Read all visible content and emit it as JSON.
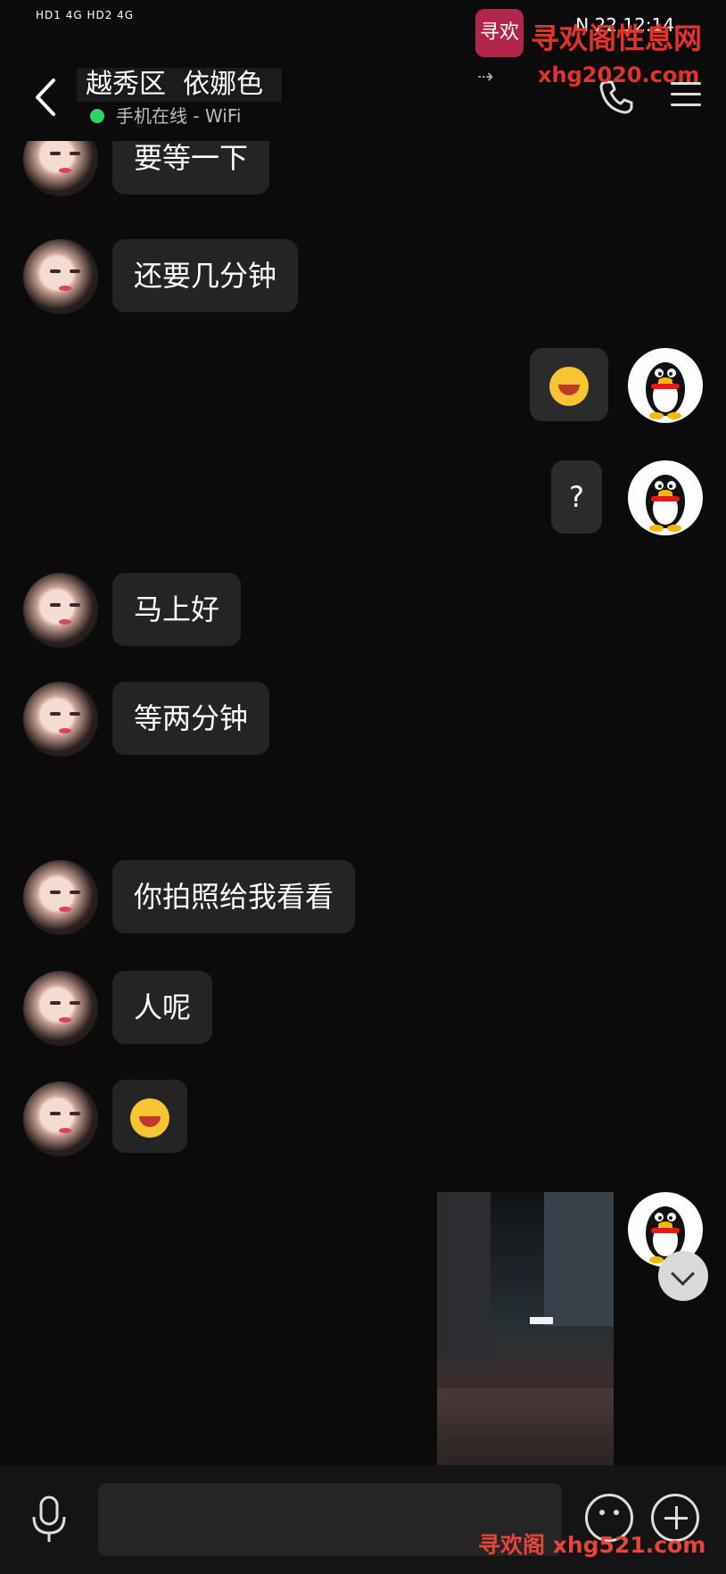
{
  "status_bar": {
    "network_left": "HD1 4G  HD2 4G",
    "right_icons": "N  22  12:14"
  },
  "header": {
    "title": "越秀区  依娜色",
    "online_status": "手机在线 - WiFi",
    "back_icon": "back-arrow-icon",
    "call_icon": "phone-icon",
    "menu_icon": "menu-icon"
  },
  "watermark": {
    "top_title": "寻欢阁性息网",
    "top_url": "xhg2020.com",
    "logo_text": "寻欢",
    "bottom": "寻欢阁 xhg521.com"
  },
  "messages": [
    {
      "side": "left",
      "text": "要等一下"
    },
    {
      "side": "left",
      "text": "还要几分钟"
    },
    {
      "side": "right",
      "type": "emoji",
      "text": ""
    },
    {
      "side": "right",
      "text": "?"
    },
    {
      "side": "left",
      "text": "马上好"
    },
    {
      "side": "left",
      "text": "等两分钟"
    },
    {
      "side": "left",
      "text": "你拍照给我看看"
    },
    {
      "side": "left",
      "text": "人呢"
    },
    {
      "side": "left",
      "type": "emoji",
      "text": ""
    },
    {
      "side": "right",
      "type": "image",
      "text": ""
    }
  ],
  "input": {
    "placeholder": ""
  }
}
